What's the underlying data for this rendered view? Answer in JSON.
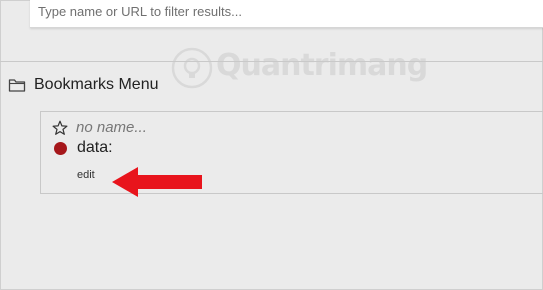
{
  "search": {
    "placeholder": "Type name or URL to filter results...",
    "value": ""
  },
  "folder": {
    "label": "Bookmarks Menu",
    "icon": "folder-icon"
  },
  "bookmark": {
    "name_placeholder": "no name...",
    "data_label": "data:",
    "edit_label": "edit",
    "dot_color": "#a5161a",
    "icons": [
      "star-icon",
      "record-dot-icon"
    ]
  },
  "annotation": {
    "arrow_color": "#e8141c"
  },
  "watermark": {
    "text": "Quantrimang"
  }
}
